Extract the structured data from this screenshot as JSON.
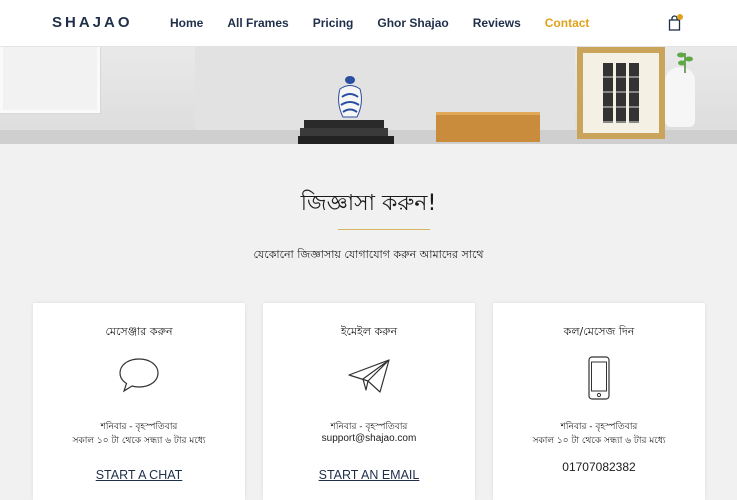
{
  "header": {
    "logo": "SHAJAO",
    "nav": [
      {
        "label": "Home",
        "active": false
      },
      {
        "label": "All Frames",
        "active": false
      },
      {
        "label": "Pricing",
        "active": false
      },
      {
        "label": "Ghor Shajao",
        "active": false
      },
      {
        "label": "Reviews",
        "active": false
      },
      {
        "label": "Contact",
        "active": true
      }
    ],
    "cart_icon": "shopping-bag-icon"
  },
  "colors": {
    "accent": "#e0a21c",
    "brand": "#1f2f4a",
    "background": "#f1f1f1"
  },
  "section": {
    "title": "জিজ্ঞাসা করুন!",
    "subtitle": "যেকোনো জিজ্ঞাসায় যোগাযোগ করুন আমাদের সাথে"
  },
  "cards": [
    {
      "title": "মেসেঞ্জার করুন",
      "icon": "chat-bubble-icon",
      "line1": "শনিবার - বৃহস্পতিবার",
      "line2": "সকাল ১০ টা থেকে সন্ধ্যা ৬ টার মধ্যে",
      "link": "START A CHAT"
    },
    {
      "title": "ইমেইল করুন",
      "icon": "paper-plane-icon",
      "line1": "শনিবার - বৃহস্পতিবার",
      "line2": "support@shajao.com",
      "link": "START AN EMAIL"
    },
    {
      "title": "কল/মেসেজ দিন",
      "icon": "mobile-phone-icon",
      "line1": "শনিবার - বৃহস্পতিবার",
      "line2": "সকাল ১০ টা থেকে সন্ধ্যা ৬ টার মধ্যে",
      "phone": "01707082382"
    }
  ]
}
